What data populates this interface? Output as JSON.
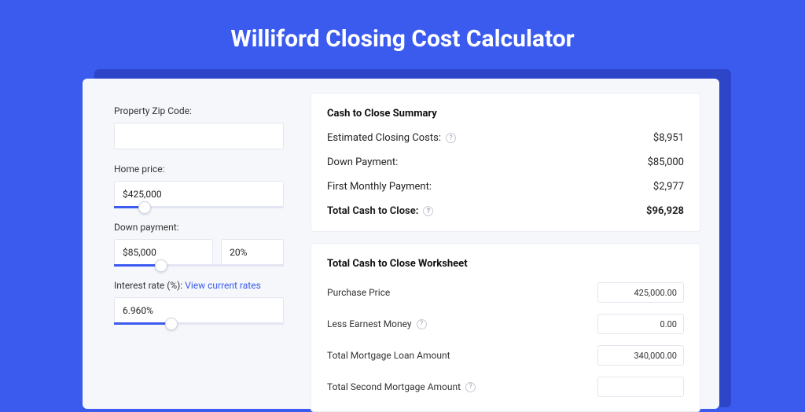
{
  "title": "Williford Closing Cost Calculator",
  "form": {
    "zip_label": "Property Zip Code:",
    "zip_value": "",
    "price_label": "Home price:",
    "price_value": "$425,000",
    "price_slider_pct": 18,
    "down_label": "Down payment:",
    "down_value": "$85,000",
    "down_pct_value": "20%",
    "down_slider_pct": 28,
    "rate_label": "Interest rate (%):",
    "rate_link_text": "View current rates",
    "rate_value": "6.960%",
    "rate_slider_pct": 34
  },
  "summary": {
    "title": "Cash to Close Summary",
    "rows": [
      {
        "label": "Estimated Closing Costs:",
        "help": true,
        "value": "$8,951",
        "bold": false
      },
      {
        "label": "Down Payment:",
        "help": false,
        "value": "$85,000",
        "bold": false
      },
      {
        "label": "First Monthly Payment:",
        "help": false,
        "value": "$2,977",
        "bold": false
      },
      {
        "label": "Total Cash to Close:",
        "help": true,
        "value": "$96,928",
        "bold": true
      }
    ]
  },
  "worksheet": {
    "title": "Total Cash to Close Worksheet",
    "rows": [
      {
        "label": "Purchase Price",
        "help": false,
        "value": "425,000.00"
      },
      {
        "label": "Less Earnest Money",
        "help": true,
        "value": "0.00"
      },
      {
        "label": "Total Mortgage Loan Amount",
        "help": false,
        "value": "340,000.00"
      },
      {
        "label": "Total Second Mortgage Amount",
        "help": true,
        "value": ""
      }
    ]
  }
}
